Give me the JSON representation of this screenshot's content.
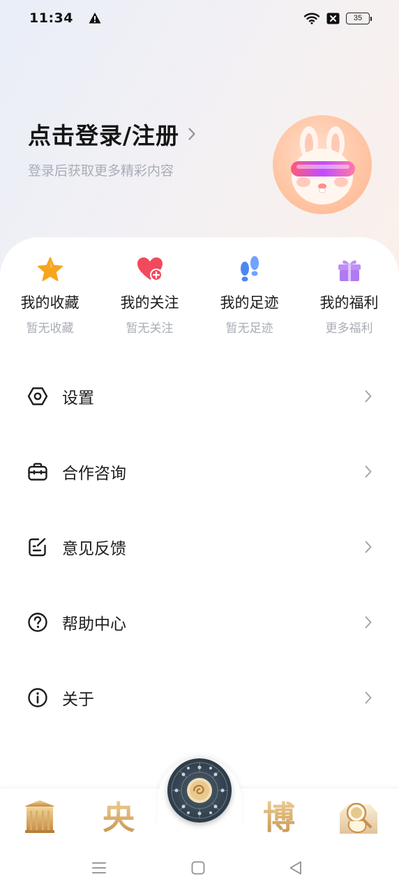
{
  "status_bar": {
    "time": "11:34",
    "battery": "35"
  },
  "header": {
    "login_title": "点击登录/注册",
    "login_subtitle": "登录后获取更多精彩内容"
  },
  "quick_links": [
    {
      "label": "我的收藏",
      "sub": "暂无收藏",
      "icon": "star-icon",
      "color": "#f6a21e"
    },
    {
      "label": "我的关注",
      "sub": "暂无关注",
      "icon": "heart-plus-icon",
      "color": "#f0475a"
    },
    {
      "label": "我的足迹",
      "sub": "暂无足迹",
      "icon": "footprints-icon",
      "color": "#4a86f2"
    },
    {
      "label": "我的福利",
      "sub": "更多福利",
      "icon": "gift-icon",
      "color": "#b27cf0"
    }
  ],
  "menu": [
    {
      "label": "设置",
      "icon": "settings-icon"
    },
    {
      "label": "合作咨询",
      "icon": "briefcase-icon"
    },
    {
      "label": "意见反馈",
      "icon": "feedback-icon"
    },
    {
      "label": "帮助中心",
      "icon": "help-icon"
    },
    {
      "label": "关于",
      "icon": "info-icon"
    }
  ],
  "bottom_nav": {
    "items": [
      {
        "icon": "pavilion-icon"
      },
      {
        "glyph": "央"
      },
      {
        "icon": "zodiac-compass-icon"
      },
      {
        "glyph": "博"
      },
      {
        "icon": "astronaut-icon"
      }
    ]
  },
  "colors": {
    "accent_gold": "#c58f45",
    "text_primary": "#1d1d1d",
    "text_secondary": "#a9adb6"
  }
}
